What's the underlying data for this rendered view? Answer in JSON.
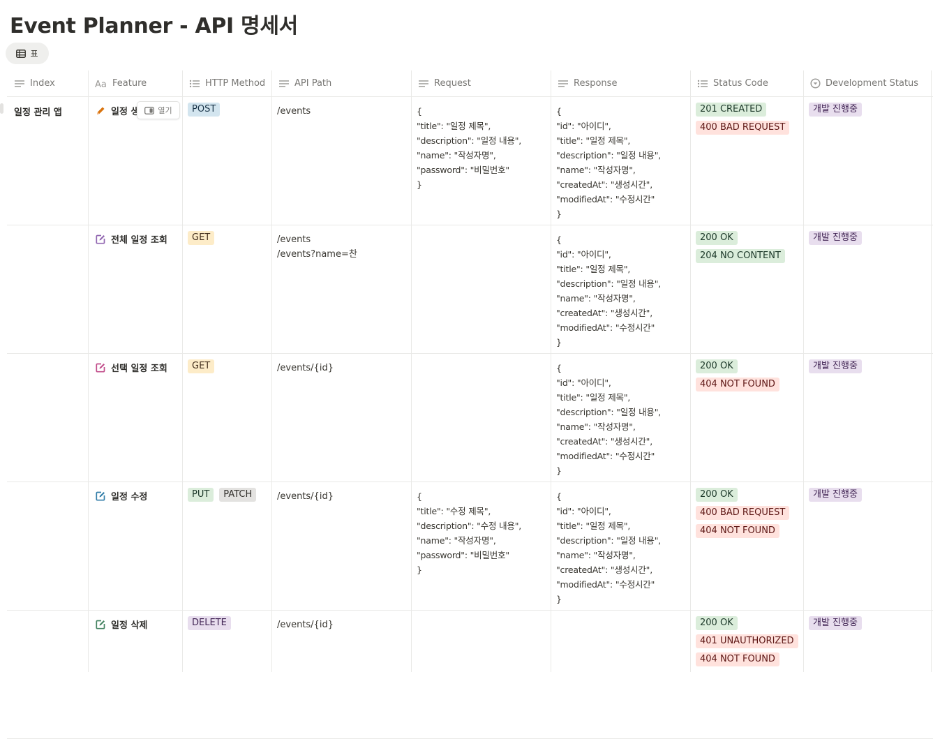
{
  "page": {
    "title": "Event Planner - API 명세서",
    "view_tab_label": "표"
  },
  "columns": [
    {
      "label": "Index",
      "icon": "text-lines-icon"
    },
    {
      "label": "Feature",
      "icon": "title-aa-icon"
    },
    {
      "label": "HTTP Method",
      "icon": "multi-select-icon"
    },
    {
      "label": "API Path",
      "icon": "text-lines-icon"
    },
    {
      "label": "Request",
      "icon": "text-lines-icon"
    },
    {
      "label": "Response",
      "icon": "text-lines-icon"
    },
    {
      "label": "Status Code",
      "icon": "multi-select-icon"
    },
    {
      "label": "Development Status",
      "icon": "status-icon"
    }
  ],
  "open_button_label": "열기",
  "rows": [
    {
      "index": "일정 관리 앱",
      "feature": "일정 생성",
      "feature_display": "일정 생",
      "feature_icon": "pencil-icon",
      "feature_icon_color": "#d9730d",
      "methods": [
        {
          "label": "POST",
          "color": "blue"
        }
      ],
      "path": "/events",
      "request": "{\n\"title\": \"일정 제목\",\n\"description\": \"일정 내용\",\n\"name\": \"작성자명\",\n\"password\": \"비밀번호\"\n}",
      "response": "{\n\"id\": \"아이디\",\n\"title\": \"일정 제목\",\n\"description\": \"일정 내용\",\n\"name\": \"작성자명\",\n\"createdAt\": \"생성시간\",\n\"modifiedAt\": \"수정시간\"\n}",
      "status_codes": [
        {
          "label": "201 CREATED",
          "color": "green"
        },
        {
          "label": "400 BAD REQUEST",
          "color": "red"
        }
      ],
      "dev_status": "개발 진행중"
    },
    {
      "index": "",
      "feature": "전체 일정 조회",
      "feature_icon": "edit-square-icon",
      "feature_icon_color": "#9065b0",
      "methods": [
        {
          "label": "GET",
          "color": "yellow"
        }
      ],
      "path": "/events\n/events?name=찬",
      "request": "",
      "response": "{\n\"id\": \"아이디\",\n\"title\": \"일정 제목\",\n\"description\": \"일정 내용\",\n\"name\": \"작성자명\",\n\"createdAt\": \"생성시간\",\n\"modifiedAt\": \"수정시간\"\n}",
      "status_codes": [
        {
          "label": "200 OK",
          "color": "green"
        },
        {
          "label": "204 NO CONTENT",
          "color": "green"
        }
      ],
      "dev_status": "개발 진행중"
    },
    {
      "index": "",
      "feature": "선택 일정 조회",
      "feature_icon": "edit-square-icon",
      "feature_icon_color": "#c14c8a",
      "methods": [
        {
          "label": "GET",
          "color": "yellow"
        }
      ],
      "path": "/events/{id}",
      "request": "",
      "response": "{\n\"id\": \"아이디\",\n\"title\": \"일정 제목\",\n\"description\": \"일정 내용\",\n\"name\": \"작성자명\",\n\"createdAt\": \"생성시간\",\n\"modifiedAt\": \"수정시간\"\n}",
      "status_codes": [
        {
          "label": "200 OK",
          "color": "green"
        },
        {
          "label": "404 NOT FOUND",
          "color": "red"
        }
      ],
      "dev_status": "개발 진행중"
    },
    {
      "index": "",
      "feature": "일정 수정",
      "feature_icon": "edit-square-icon",
      "feature_icon_color": "#337ea9",
      "methods": [
        {
          "label": "PUT",
          "color": "green"
        },
        {
          "label": "PATCH",
          "color": "gray"
        }
      ],
      "path": "/events/{id}",
      "request": "{\n\"title\": \"수정 제목\",\n\"description\": \"수정 내용\",\n\"name\": \"작성자명\",\n\"password\": \"비밀번호\"\n}",
      "response": "{\n\"id\": \"아이디\",\n\"title\": \"일정 제목\",\n\"description\": \"일정 내용\",\n\"name\": \"작성자명\",\n\"createdAt\": \"생성시간\",\n\"modifiedAt\": \"수정시간\"\n}",
      "status_codes": [
        {
          "label": "200 OK",
          "color": "green"
        },
        {
          "label": "400 BAD REQUEST",
          "color": "red"
        },
        {
          "label": "404 NOT FOUND",
          "color": "red"
        }
      ],
      "dev_status": "개발 진행중"
    },
    {
      "index": "",
      "feature": "일정 삭제",
      "feature_icon": "edit-square-icon",
      "feature_icon_color": "#448361",
      "methods": [
        {
          "label": "DELETE",
          "color": "purple"
        }
      ],
      "path": "/events/{id}",
      "request": "",
      "response": "",
      "status_codes": [
        {
          "label": "200 OK",
          "color": "green"
        },
        {
          "label": "401 UNAUTHORIZED",
          "color": "red"
        },
        {
          "label": "404 NOT FOUND",
          "color": "red"
        }
      ],
      "dev_status": "개발 진행중"
    }
  ]
}
